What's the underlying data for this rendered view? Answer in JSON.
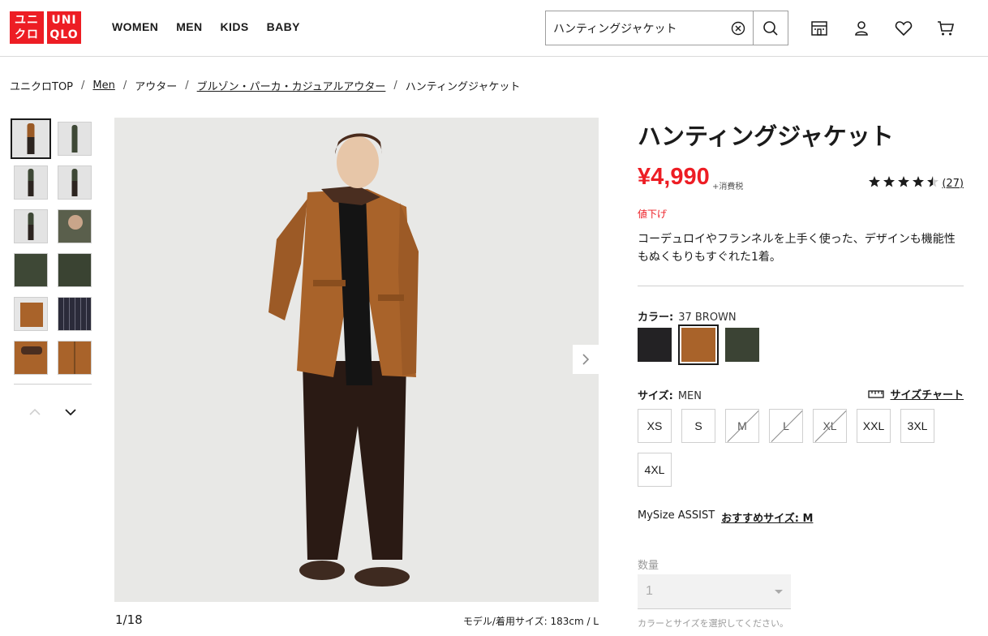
{
  "brand": {
    "logo_left": "ユニ\nクロ",
    "logo_right": "UNI\nQLO",
    "red": "#ed1d24"
  },
  "nav": [
    "WOMEN",
    "MEN",
    "KIDS",
    "BABY"
  ],
  "search": {
    "value": "ハンティングジャケット"
  },
  "header_icons": [
    "store-icon",
    "user-icon",
    "heart-icon",
    "cart-icon"
  ],
  "breadcrumb": {
    "items": [
      "ユニクロTOP",
      "Men",
      "アウター",
      "ブルゾン・パーカ・カジュアルアウター",
      "ハンティングジャケット"
    ],
    "separator": "/"
  },
  "gallery": {
    "counter": "1/18",
    "model_size": "モデル/着用サイズ: 183cm / L",
    "thumbnails": 12
  },
  "product": {
    "title": "ハンティングジャケット",
    "price": "¥4,990",
    "tax": "+消費税",
    "rating_value": 4.5,
    "review_count": "(27)",
    "sale_badge": "値下げ",
    "description": "コーデュロイやフランネルを上手く使った、デザインも機能性もぬくもりもすぐれた1着。"
  },
  "color": {
    "label": "カラー:",
    "selected_name": "37 BROWN",
    "swatches": [
      {
        "name": "black",
        "hex": "#232224"
      },
      {
        "name": "brown",
        "hex": "#a9632a",
        "selected": true
      },
      {
        "name": "olive",
        "hex": "#3b4334"
      }
    ]
  },
  "size": {
    "label": "サイズ:",
    "selected_group": "MEN",
    "chart_link": "サイズチャート",
    "options": [
      {
        "label": "XS",
        "available": true
      },
      {
        "label": "S",
        "available": true
      },
      {
        "label": "M",
        "available": false
      },
      {
        "label": "L",
        "available": false
      },
      {
        "label": "XL",
        "available": false
      },
      {
        "label": "XXL",
        "available": true
      },
      {
        "label": "3XL",
        "available": true
      },
      {
        "label": "4XL",
        "available": true
      }
    ]
  },
  "mysize": {
    "label": "MySize ASSIST",
    "recommendation": "おすすめサイズ: M"
  },
  "quantity": {
    "label": "数量",
    "value": "1",
    "note": "カラーとサイズを選択してください。"
  }
}
